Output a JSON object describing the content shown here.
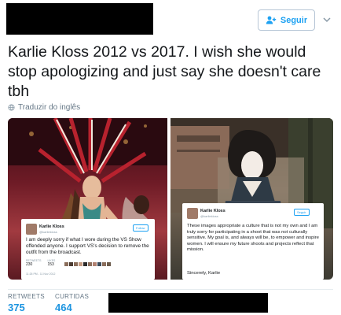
{
  "header": {
    "follow_label": "Seguir"
  },
  "tweet": {
    "text": "Karlie Kloss 2012 vs 2017. I wish she would stop apologizing and just say she doesn't care tbh",
    "translate_label": "Traduzir do inglês"
  },
  "media": {
    "left_card": {
      "name": "Karlie Kloss",
      "handle": "@karliekloss",
      "follow_label": "Follow",
      "body": "I am deeply sorry if what I wore during the VS Show offended anyone. I support VS's decision to remove the outfit from the broadcast.",
      "retweets_label": "RETWEETS",
      "retweets_value": "230",
      "likes_label": "LIKES",
      "likes_value": "153",
      "date": "11:26 PM - 11 Nov 2012"
    },
    "right_card": {
      "name": "Karlie Kloss",
      "handle": "@karliekloss",
      "follow_label": "Seguir",
      "body": "These images appropriate a culture that is not my own and I am truly sorry for participating in a shoot that was not culturally sensitive. My goal is, and always will be, to empower and inspire women. I will ensure my future shoots and projects reflect that mission.",
      "signoff": "Sincerely, Karlie"
    }
  },
  "stats": {
    "retweets_label": "RETWEETS",
    "retweets_value": "375",
    "likes_label": "CURTIDAS",
    "likes_value": "464"
  },
  "colors": {
    "accent": "#1da1f2",
    "stat_value": "#1c94e0",
    "muted": "#657786"
  }
}
